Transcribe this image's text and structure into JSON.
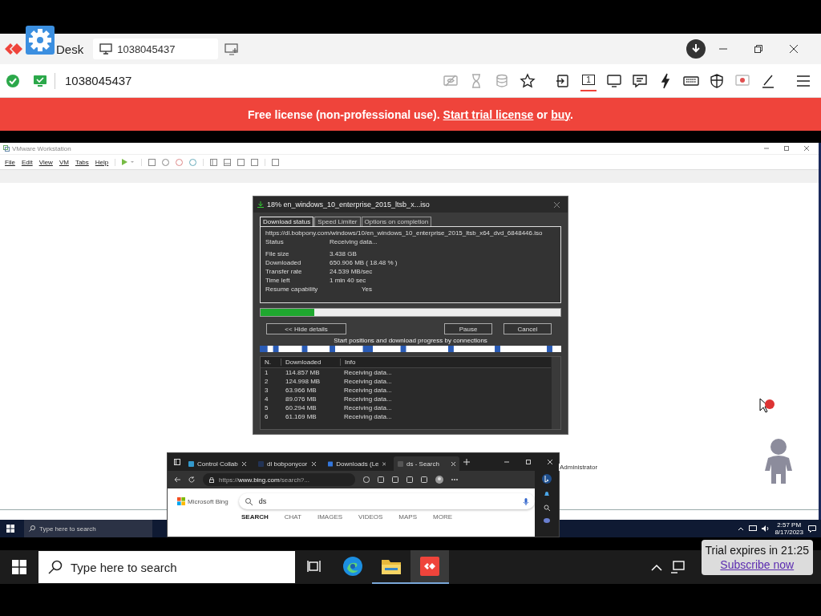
{
  "anydesk": {
    "app_name": "Desk",
    "tab_label": "1038045437",
    "address": "1038045437",
    "display": {
      "label": "1",
      "selected": true
    }
  },
  "banner": {
    "text": "Free license (non-professional use). ",
    "link1": "Start trial license",
    "middle": " or ",
    "link2": "buy",
    "end": "."
  },
  "vmware": {
    "title": "VMware Workstation",
    "menu": [
      "File",
      "Edit",
      "View",
      "VM",
      "Tabs",
      "Help"
    ]
  },
  "download_dialog": {
    "title": "18% en_windows_10_enterprise_2015_ltsb_x...iso",
    "tabs": [
      {
        "label": "Download status",
        "selected": true
      },
      {
        "label": "Speed Limiter",
        "selected": false
      },
      {
        "label": "Options on completion",
        "selected": false
      }
    ],
    "url": "https://dl.bobpony.com/windows/10/en_windows_10_enterprise_2015_ltsb_x64_dvd_6848446.iso",
    "status": {
      "label": "Status",
      "value": "Receiving data..."
    },
    "details": [
      {
        "label": "File size",
        "value": "3.438  GB"
      },
      {
        "label": "Downloaded",
        "value": "650.906  MB  ( 18.48 % )"
      },
      {
        "label": "Transfer rate",
        "value": "24.539  MB/sec"
      },
      {
        "label": "Time left",
        "value": "1 min 40 sec"
      },
      {
        "label": "Resume capability",
        "value": "Yes"
      }
    ],
    "progress": {
      "level": 0.18
    },
    "buttons": [
      "<< Hide details",
      "Pause",
      "Cancel"
    ],
    "connections_caption": "Start positions and download progress by connections",
    "table": {
      "columns": [
        "N.",
        "Downloaded",
        "Info"
      ],
      "rows": [
        [
          "1",
          "114.857  MB",
          "Receiving data..."
        ],
        [
          "2",
          "124.998  MB",
          "Receiving data..."
        ],
        [
          "3",
          "63.966  MB",
          "Receiving data..."
        ],
        [
          "4",
          "89.076  MB",
          "Receiving data..."
        ],
        [
          "5",
          "60.294  MB",
          "Receiving data..."
        ],
        [
          "6",
          "61.169  MB",
          "Receiving data..."
        ]
      ]
    }
  },
  "browser": {
    "tabs": [
      {
        "label": "Control Collab",
        "selected": false
      },
      {
        "label": "dl bobponycor",
        "selected": false
      },
      {
        "label": "Downloads (Le",
        "selected": false
      },
      {
        "label": "ds - Search",
        "selected": true
      }
    ],
    "address": "https://**www.bing.com**/search?...",
    "brand": "Microsoft Bing",
    "query": "ds",
    "nav": [
      {
        "label": "SEARCH",
        "selected": true
      },
      {
        "label": "CHAT",
        "selected": false
      },
      {
        "label": "IMAGES",
        "selected": false
      },
      {
        "label": "VIDEOS",
        "selected": false
      },
      {
        "label": "MAPS",
        "selected": false
      },
      {
        "label": "MORE",
        "selected": false
      }
    ]
  },
  "tooltip": "Administrator",
  "remote_taskbar": {
    "search_placeholder": "Type here to search",
    "time": "2:57 PM",
    "date": "8/17/2023"
  },
  "local_taskbar": {
    "search_placeholder": "Type here to search",
    "apps": [
      {
        "kind": "edge",
        "selected": false
      },
      {
        "kind": "folder",
        "selected": false
      },
      {
        "kind": "anydesk",
        "selected": true
      }
    ]
  },
  "trial": {
    "text": "Trial expires in 21:25",
    "link": "Subscribe now"
  }
}
